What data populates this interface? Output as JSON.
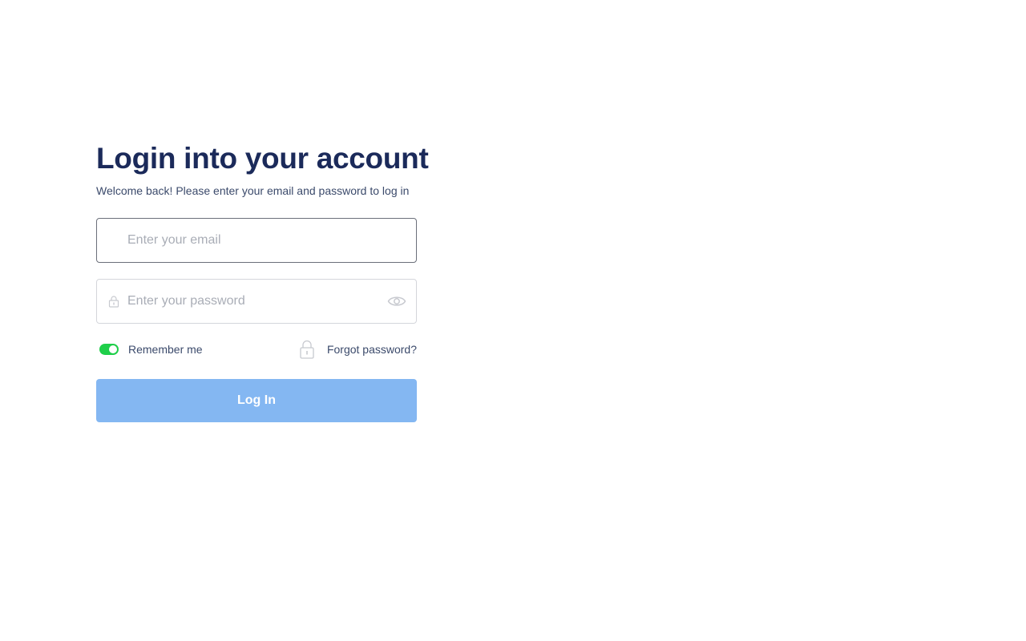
{
  "header": {
    "title": "Login into your account",
    "subtitle": "Welcome back! Please enter your email and password to log in"
  },
  "form": {
    "email": {
      "value": "",
      "placeholder": "Enter your email"
    },
    "password": {
      "value": "",
      "placeholder": "Enter your password",
      "leading_icon": "lock-icon",
      "toggle_icon": "eye-icon"
    },
    "remember_me": {
      "label": "Remember me",
      "checked": true,
      "color": "#1fcf4a"
    },
    "forgot_password": {
      "label": "Forgot password?",
      "icon": "lock-icon"
    },
    "submit": {
      "label": "Log In",
      "color": "#84b7f2"
    }
  },
  "colors": {
    "title": "#1b2a5a",
    "text": "#3b4a6b"
  }
}
